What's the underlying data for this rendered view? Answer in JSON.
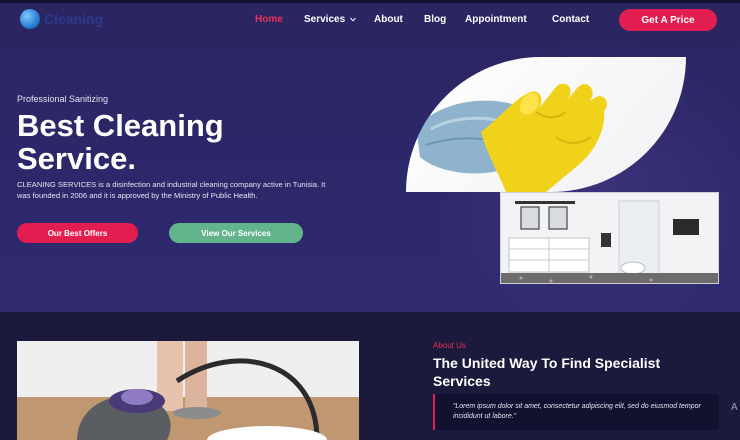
{
  "brand": {
    "name": "Cleaning",
    "icon": "logo-globe-icon"
  },
  "nav": {
    "items": [
      {
        "label": "Home",
        "active": true
      },
      {
        "label": "Services",
        "has_dropdown": true,
        "dropdown_icon": "chevron-down-icon"
      },
      {
        "label": "About"
      },
      {
        "label": "Blog"
      },
      {
        "label": "Appointment"
      },
      {
        "label": "Contact"
      }
    ],
    "cta": "Get A Price"
  },
  "hero": {
    "eyebrow": "Professional Sanitizing",
    "title_line1": "Best Cleaning",
    "title_line2": "Service.",
    "description": "CLEANING SERVICES is a disinfection and industrial cleaning company active in Tunisia. It was founded in 2006 and it is approved by the Ministry of Public Health.",
    "primary_button": "Our Best Offers",
    "secondary_button": "View Our Services"
  },
  "about": {
    "label": "About Us",
    "title": "The United Way To Find Specialist Services",
    "quote": "“Lorem ipsum dolor sit amet, consectetur adipiscing elit, sed do eiusmod tempor incididunt ut labore.”",
    "edge_fragment": "A"
  },
  "colors": {
    "accent": "#e21d4f",
    "secondary_button": "#63b48d",
    "hero_bg": "#2c2768",
    "section_bg": "#1b1a3c"
  }
}
